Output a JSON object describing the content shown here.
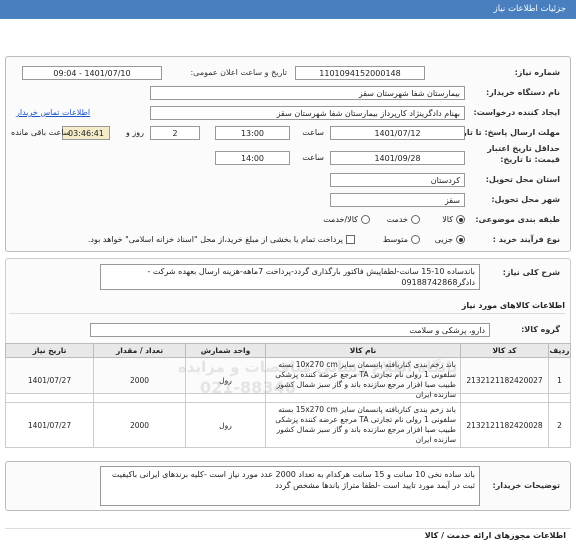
{
  "header": {
    "title": "جزئیات اطلاعات نیاز"
  },
  "info": {
    "need_number_label": "شماره نیاز:",
    "need_number": "1101094152000148",
    "announce_label": "تاریخ و ساعت اعلان عمومی:",
    "announce_value": "1401/07/10 - 09:04",
    "buyer_label": "نام دستگاه خریدار:",
    "buyer": "بیمارستان شفا شهرستان سقز",
    "creator_label": "ایجاد کننده درخواست:",
    "creator": "بهنام دادگرینژاد کارپرداز بیمارستان شفا شهرستان سقز",
    "contact_link": "اطلاعات تماس خریدار",
    "send_deadline_label": "مهلت ارسال پاسخ: تا تاریخ:",
    "send_date": "1401/07/12",
    "time_label": "ساعت",
    "send_time": "13:00",
    "days_value": "2",
    "days_label": "روز و",
    "remaining": "03:46:41",
    "remaining_label": "ساعت باقی مانده",
    "validity_label": "حداقل تاریخ اعتبار قیمت: تا تاریخ:",
    "validity_date": "1401/09/28",
    "validity_time": "14:00",
    "province_label": "استان محل تحویل:",
    "province": "کردستان",
    "city_label": "شهر محل تحویل:",
    "city": "سقز",
    "category_label": "طبقه بندی موضوعی:",
    "cat_goods": "کالا",
    "cat_service": "خدمت",
    "cat_both": "کالا/خدمت",
    "process_label": "نوع فرآیند خرید :",
    "proc_minor": "جزیی",
    "proc_medium": "متوسط",
    "payment_note": "پرداخت تمام یا بخشی از مبلغ خرید،از محل \"اسناد خزانه اسلامی\" خواهد بود."
  },
  "summary": {
    "label": "شرح کلی نیاز:",
    "text1": "باندساده 10-15 سانت-لطفاپیش فاکتور بارگذاری گردد-پرداخت 7ماهه-هزینه ارسال بعهده شرکت -",
    "text2": "دادگر09188742868"
  },
  "goods": {
    "title": "اطلاعات کالاهای مورد نیاز",
    "group_label": "گروه کالا:",
    "group": "دارو، پزشکی و سلامت",
    "columns": [
      "ردیف",
      "کد کالا",
      "نام کالا",
      "واحد شمارش",
      "تعداد / مقدار",
      "تاریخ نیاز"
    ],
    "rows": [
      {
        "idx": "1",
        "code": "2132121182420027",
        "name": "باند زخم بندی کناربافته پانسمان سایز 10x270 cm بسته سلفونی 1 رولی نام تجارتی TA مرجع عرضه کننده پزشکی طبیب صبا افزار مرجع سازنده باند و گاز سبز شمال کشور سازنده ایران",
        "unit": "رول",
        "qty": "2000",
        "date": "1401/07/27"
      },
      {
        "idx": "2",
        "code": "2132121182420028",
        "name": "باند زخم بندی کناربافته پانسمان سایز 15x270 cm بسته سلفونی 1 رولی نام تجارتی TA مرجع عرضه کننده پزشکی طبیب صبا افزار مرجع سازنده باند و گاز سبز شمال کشور سازنده ایران",
        "unit": "رول",
        "qty": "2000",
        "date": "1401/07/27"
      }
    ]
  },
  "buyer_notes": {
    "label": "توضیحات خریدار:",
    "text": "باند ساده نخی 10 سانت و 15 سانت هرکدام به تعداد 2000 عدد مورد نیاز است -کلیه برندهای ایرانی باکیفیت ثبت در آیمد مورد تایید است -لطفا متراژ باندها مشخص گردد"
  },
  "permits": {
    "title": "اطلاعات مجوزهای ارائه خدمت / کالا"
  },
  "watermark": {
    "line1": "پایگاه اطلاع رسانی مناقصات و مزایده",
    "line2": "021-88346"
  }
}
